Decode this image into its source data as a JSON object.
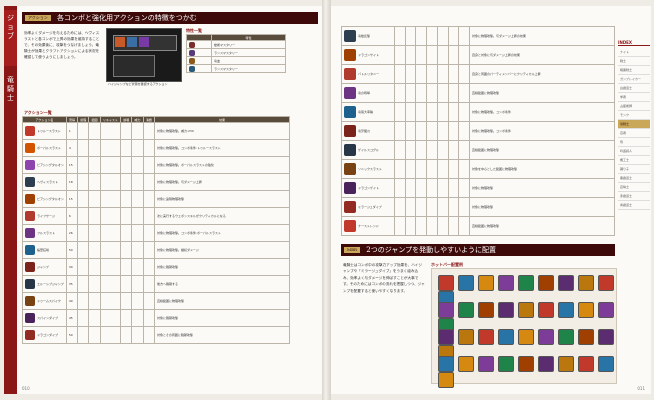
{
  "left": {
    "spine": {
      "label1": "ジョブ",
      "label2": "竜騎士"
    },
    "section": {
      "tag": "アクション",
      "title": "各コンボと強化用アクションの特徴をつかむ"
    },
    "intro": "効率よくダメージを与えるためには、ヘヴィスラストと各コンボで上昇の効果を維持することで、その効果後に、攻撃をつなげましょう。竜騎士が効果とクラフトアクションによる状況を確認して使うようにしましょう。",
    "shot_caption": "ハイジャンプなど状態を確認するアクション",
    "trait_header": "特性一覧",
    "trait_col": "特性",
    "traits": [
      "槍術マスタリー",
      "ランスマスタリー",
      "竜血",
      "ランスマスタリー"
    ],
    "action_header": "アクション一覧",
    "columns": [
      "アクション名",
      "習得",
      "射程",
      "範囲",
      "リキャスト",
      "詠唱",
      "威力",
      "消費",
      "効果"
    ],
    "rows": [
      {
        "name": "トゥルースラスト",
        "lv": "1",
        "eff": "対象に物理攻撃。威力:230"
      },
      {
        "name": "ボーパルスラスト",
        "lv": "4",
        "eff": "対象に物理攻撃。コンボ条件:トゥルースラスト"
      },
      {
        "name": "ピアシングタルオン",
        "lv": "15",
        "eff": "対象に物理攻撃。ボーパルスラストの強化"
      },
      {
        "name": "ヘヴィスラスト",
        "lv": "18",
        "eff": "対象に物理攻撃。与ダメージ上昇"
      },
      {
        "name": "ピアシングタルオン",
        "lv": "15",
        "eff": "対象に遠隔物理攻撃"
      },
      {
        "name": "ライフサージ",
        "lv": "6",
        "eff": "次に実行するウェポンスキルがクリティカルになる"
      },
      {
        "name": "フルスラスト",
        "lv": "26",
        "eff": "対象に物理攻撃。コンボ条件:ボーパルスラスト"
      },
      {
        "name": "桜華狂咲",
        "lv": "50",
        "eff": "対象に物理攻撃。継続ダメージ"
      },
      {
        "name": "ジャンプ",
        "lv": "30",
        "eff": "対象に跳躍攻撃"
      },
      {
        "name": "エルーシブジャンプ",
        "lv": "35",
        "eff": "後方へ跳躍する"
      },
      {
        "name": "ドゥームスパイク",
        "lv": "40",
        "eff": "直線範囲に物理攻撃"
      },
      {
        "name": "スパインダイブ",
        "lv": "45",
        "eff": "対象に跳躍攻撃"
      },
      {
        "name": "ドラゴンダイブ",
        "lv": "50",
        "eff": "対象とその周囲に跳躍攻撃"
      }
    ],
    "page_no": "010"
  },
  "right": {
    "table_rows": [
      {
        "name": "竜槍反撃",
        "eff": "対象に物理攻撃。与ダメージ上昇の効果"
      },
      {
        "name": "ドラゴンサイト",
        "eff": "自身と対象に与ダメージ上昇の効果"
      },
      {
        "name": "バトルリタニー",
        "eff": "自身と周囲のパーティメンバーにクリティカル上昇"
      },
      {
        "name": "竜の咆哮",
        "eff": "直線範囲に物理攻撃"
      },
      {
        "name": "竜尾大車輪",
        "eff": "対象に物理攻撃。コンボ条件"
      },
      {
        "name": "竜牙龍爪",
        "eff": "対象に物理攻撃。コンボ条件"
      },
      {
        "name": "ゲイルスコグル",
        "eff": "直線範囲に物理攻撃"
      },
      {
        "name": "ソニックスラスト",
        "eff": "対象を中心とした範囲に物理攻撃"
      },
      {
        "name": "ドラゴンゲイト",
        "eff": "対象に物理攻撃"
      },
      {
        "name": "ミラージュダイブ",
        "eff": "対象に物理攻撃"
      },
      {
        "name": "ナーストレンド",
        "eff": "直線範囲に物理攻撃"
      }
    ],
    "section": {
      "tag": "MBR",
      "title": "2つのジャンプを発動しやすいように配置"
    },
    "prose": "竜騎士はコンボ中の攻撃力アップ効果を、ハイジャンプや「ミラージュダイブ」をうまく組み込み、効率よく与ダメージを伸ばすことが大事です。そのためにはコンボの流れを把握しつつ、ジャンプを配置すると使いやすくなります。",
    "example_header": "ホットバー配置例",
    "index_title": "INDEX",
    "index_items": [
      "ナイト",
      "戦士",
      "暗黒騎士",
      "ガンブレイカー",
      "白魔道士",
      "学者",
      "占星術師",
      "モンク",
      "竜騎士",
      "忍者",
      "侍",
      "吟遊詩人",
      "機工士",
      "踊り子",
      "黒魔道士",
      "召喚士",
      "赤魔道士",
      "青魔道士"
    ],
    "page_no": "011"
  }
}
